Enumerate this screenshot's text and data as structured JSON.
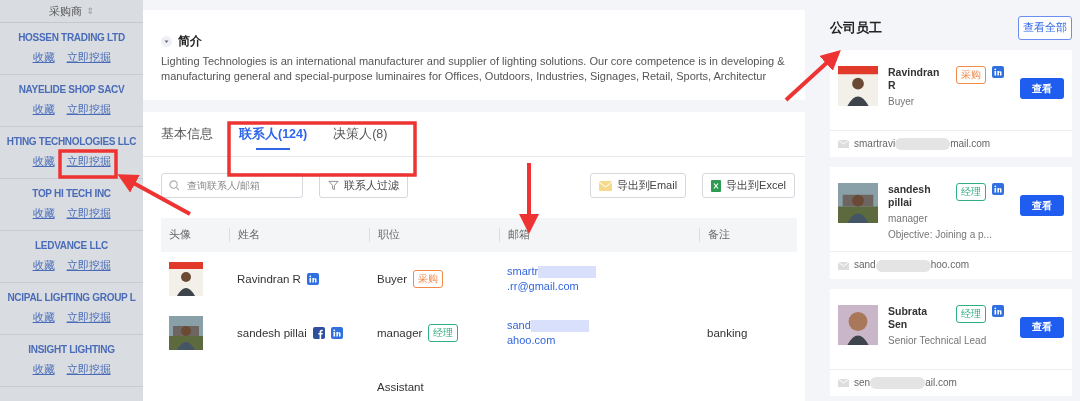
{
  "buyers": {
    "header": "采购商",
    "sort_icon": "⇕",
    "items": [
      {
        "name": "HOSSEN TRADING LTD",
        "links": [
          "收藏",
          "立即挖掘"
        ]
      },
      {
        "name": "NAYELIDE SHOP SACV",
        "links": [
          "收藏",
          "立即挖掘"
        ]
      },
      {
        "name": "HTING TECHNOLOGIES LLC",
        "links": [
          "收藏",
          "立即挖掘"
        ]
      },
      {
        "name": "TOP HI TECH INC",
        "links": [
          "收藏",
          "立即挖掘"
        ]
      },
      {
        "name": "LEDVANCE LLC",
        "links": [
          "收藏",
          "立即挖掘"
        ]
      },
      {
        "name": "NCIPAL LIGHTING GROUP L",
        "links": [
          "收藏",
          "立即挖掘"
        ]
      },
      {
        "name": "INSIGHT LIGHTING",
        "links": [
          "收藏",
          "立即挖掘"
        ]
      }
    ]
  },
  "intro": {
    "title": "简介",
    "text": "Lighting Technologies is an international manufacturer and supplier of lighting solutions. Our core competence is in developing & manufacturing general and special-purpose luminaires for Offices, Outdoors, Industries, Signages, Retail, Sports, Architectur"
  },
  "tabs": [
    {
      "label": "基本信息",
      "selected": false
    },
    {
      "label": "联系人(124)",
      "selected": true
    },
    {
      "label": "决策人(8)",
      "selected": false
    }
  ],
  "toolbar": {
    "search": {
      "placeholder": "查询联系人/邮箱"
    },
    "filter": "联系人过滤",
    "export_email": "导出到Email",
    "export_excel": "导出到Excel"
  },
  "table": {
    "columns": [
      "头像",
      "姓名",
      "职位",
      "邮箱",
      "备注"
    ],
    "rows": [
      {
        "name": "Ravindran R",
        "profiles": {
          "facebook": false,
          "linkedin": true
        },
        "position": "Buyer",
        "tag": {
          "label": "采购",
          "color": "#f08a4b"
        },
        "email_start": "smartr",
        "email_end": ".rr@gmail.com"
      },
      {
        "name": "sandesh pillai",
        "profiles": {
          "facebook": true,
          "linkedin": true
        },
        "position": "manager",
        "tag": {
          "label": "经理",
          "color": "#2fae7f"
        },
        "email_start": "sand",
        "email_end": "ahoo.com",
        "note": "banking"
      },
      {
        "position": "Assistant"
      }
    ]
  },
  "employees": {
    "title": "公司员工",
    "view_all": "查看全部",
    "cards": [
      {
        "name": "Ravindran R",
        "tag": {
          "label": "采购",
          "color": "#f08a4b"
        },
        "profiles": {
          "facebook": false,
          "linkedin": true
        },
        "role": "Buyer",
        "button": "查看",
        "email_start": "smartravi",
        "email_end": "mail.com"
      },
      {
        "name": "sandesh pillai",
        "tag": {
          "label": "经理",
          "color": "#2fae7f"
        },
        "profiles": {
          "facebook": false,
          "linkedin": true
        },
        "role": "manager",
        "summary": "Objective: Joining a p...",
        "button": "查看",
        "email_start": "sand",
        "email_end": "hoo.com"
      },
      {
        "name": "Subrata Sen",
        "tag": {
          "label": "经理",
          "color": "#2fae7f"
        },
        "profiles": {
          "facebook": false,
          "linkedin": true
        },
        "role": "Senior Technical Lead",
        "button": "查看",
        "email_start": "sen",
        "email_end": "ail.com"
      }
    ]
  }
}
